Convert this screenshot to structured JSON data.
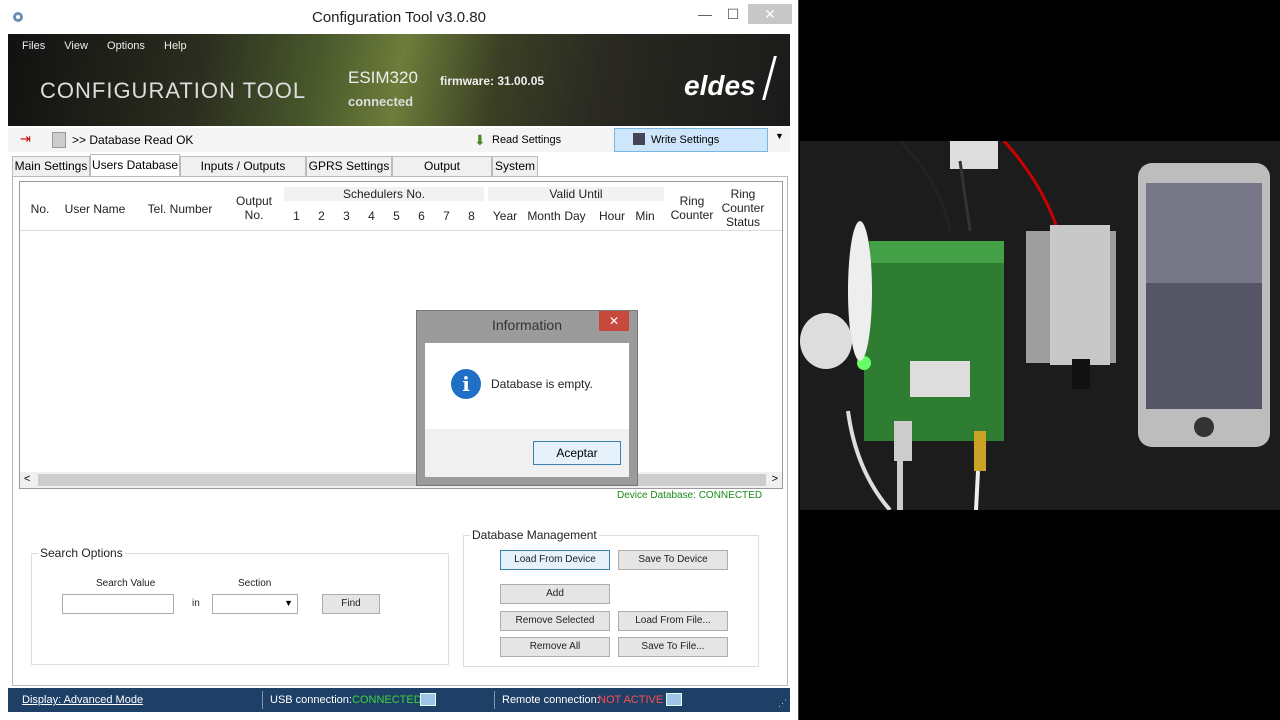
{
  "window": {
    "title": "Configuration Tool v3.0.80",
    "minimize": "—",
    "maximize": "☐",
    "close": "✕"
  },
  "banner": {
    "menu": [
      "Files",
      "View",
      "Options",
      "Help"
    ],
    "app_name": "CONFIGURATION TOOL",
    "device_model": "ESIM320",
    "device_status": "connected",
    "firmware": "firmware: 31.00.05",
    "logo": "eldes"
  },
  "toolbar": {
    "status": ">> Database Read OK",
    "read_settings": "Read Settings",
    "write_settings": "Write Settings"
  },
  "tabs": [
    "Main Settings",
    "Users Database",
    "Inputs / Outputs Control",
    "GPRS Settings",
    "Output Schedulers",
    "System"
  ],
  "active_tab": "Users Database",
  "grid": {
    "col_no": "No.",
    "col_user": "User Name",
    "col_tel": "Tel. Number",
    "col_output": "Output No.",
    "schedulers_group": "Schedulers No.",
    "scheduler_nums": [
      "1",
      "2",
      "3",
      "4",
      "5",
      "6",
      "7",
      "8"
    ],
    "valid_group": "Valid Until",
    "valid_cols": [
      "Year",
      "Month",
      "Day",
      "Hour",
      "Min"
    ],
    "ring_counter": "Ring Counter",
    "ring_counter_status": "Ring Counter Status",
    "scroll_left": "<",
    "scroll_right": ">"
  },
  "device_db": "Device Database: CONNECTED",
  "search": {
    "title": "Search Options",
    "value_label": "Search Value",
    "in_label": "in",
    "section_label": "Section",
    "find": "Find"
  },
  "db_mgmt": {
    "title": "Database Management",
    "load_from_device": "Load From Device",
    "save_to_device": "Save To Device",
    "add": "Add",
    "remove_selected": "Remove Selected",
    "load_from_file": "Load From File...",
    "remove_all": "Remove All",
    "save_to_file": "Save To File..."
  },
  "statusbar": {
    "display_mode": "Display: Advanced Mode",
    "usb_label": "USB connection:",
    "usb_value": "CONNECTED",
    "remote_label": "Remote connection:",
    "remote_value": "NOT ACTIVE"
  },
  "dialog": {
    "title": "Information",
    "close": "✕",
    "message": "Database is empty.",
    "ok": "Aceptar"
  }
}
